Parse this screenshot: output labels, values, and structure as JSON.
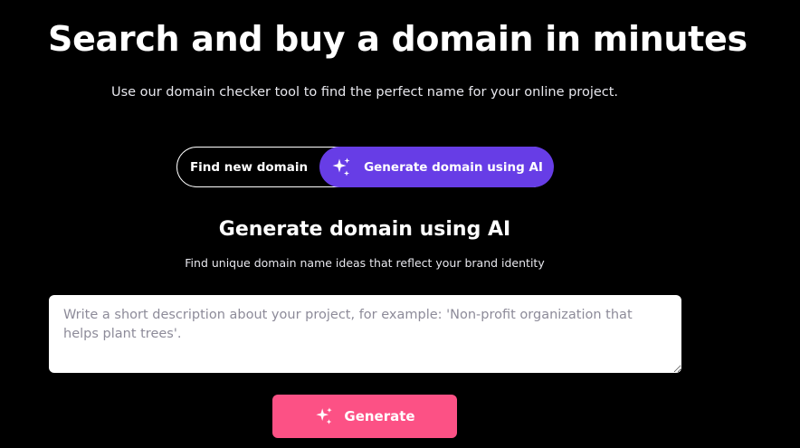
{
  "hero": {
    "title": "Search and buy a domain in minutes",
    "subtitle": "Use our domain checker tool to find the perfect name for your online project."
  },
  "tabs": [
    {
      "label": "Find new domain",
      "active": false
    },
    {
      "label": "Generate domain using AI",
      "active": true,
      "icon": "sparkles-icon"
    }
  ],
  "section": {
    "title": "Generate domain using AI",
    "subtitle": "Find unique domain name ideas that reflect your brand identity"
  },
  "input": {
    "value": "",
    "placeholder": "Write a short description about your project, for example: 'Non-profit organization that helps plant trees'."
  },
  "generate_button": {
    "label": "Generate",
    "icon": "sparkles-icon"
  },
  "colors": {
    "background": "#000000",
    "active_tab": "#673de6",
    "generate_button": "#fc5185",
    "input_background": "#ffffff",
    "placeholder": "#8d8b99"
  }
}
